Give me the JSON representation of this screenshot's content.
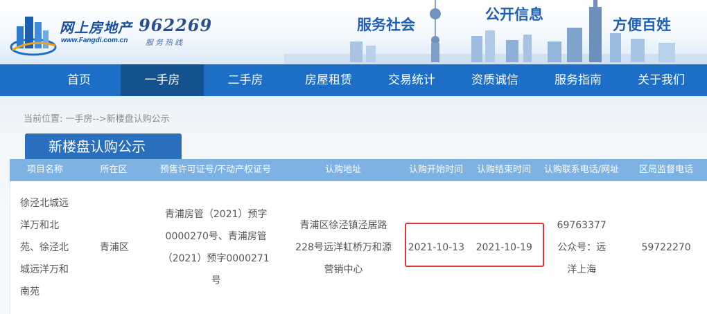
{
  "header": {
    "logo_name": "网上房地产",
    "logo_url": "www.Fangdi.com.cn",
    "hotline_number": "962269",
    "hotline_label": "服务热线",
    "slogans": [
      "服务社会",
      "公开信息",
      "方便百姓"
    ]
  },
  "nav": {
    "items": [
      "首页",
      "一手房",
      "二手房",
      "房屋租赁",
      "交易统计",
      "资质诚信",
      "服务指南",
      "关于我们"
    ],
    "active_index": 1
  },
  "breadcrumb": "当前位置: 一手房-->新楼盘认购公示",
  "section_title": "新楼盘认购公示",
  "table": {
    "headers": [
      "项目名称",
      "所在区",
      "预售许可证号/不动产权证号",
      "认购地址",
      "认购开始时间",
      "认购结束时间",
      "认购联系电话/网址",
      "区局监督电话"
    ],
    "rows": [
      [
        "徐泾北城远洋万和北苑、徐泾北城远洋万和南苑",
        "青浦区",
        "青浦房管（2021）预字0000270号、青浦房管（2021）预字0000271号",
        "青浦区徐泾镇泾居路228号远洋虹桥万和源营销中心",
        "2021-10-13",
        "2021-10-19",
        "69763377 公众号：远洋上海",
        "59722270"
      ]
    ]
  },
  "colors": {
    "nav_bg": "#1c6ec7",
    "nav_active_bg": "#13528f",
    "table_header_bg": "#7eb2e2",
    "section_tab_bg": "#2a6fbd",
    "highlight_border": "#e03434"
  }
}
